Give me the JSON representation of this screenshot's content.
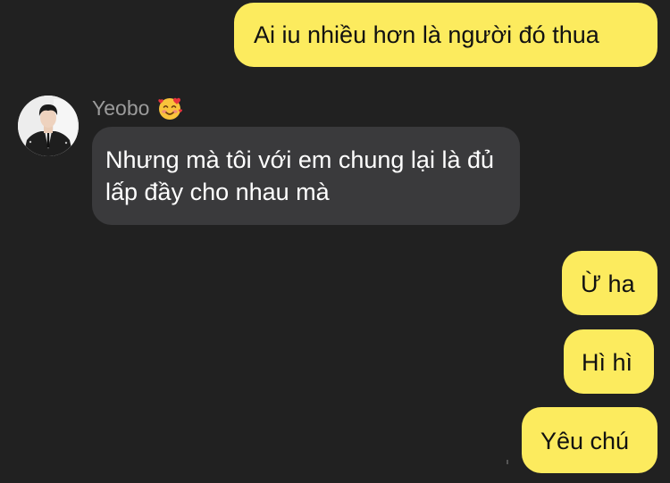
{
  "messages": {
    "out_1": "Ai iu nhiều hơn là người đó thua",
    "in_1": "Nhưng mà tôi với em chung lại là đủ lấp đầy cho nhau mà",
    "out_2": "Ừ ha",
    "out_3": "Hì hì",
    "out_4": "Yêu chú"
  },
  "sender": {
    "name": "Yeobo",
    "emoji": "smiling-face-with-hearts-icon"
  },
  "colors": {
    "background": "#212121",
    "outgoing_bubble": "#FCEB5E",
    "incoming_bubble": "#3A3A3C",
    "sender_name": "#9B9B9B"
  }
}
